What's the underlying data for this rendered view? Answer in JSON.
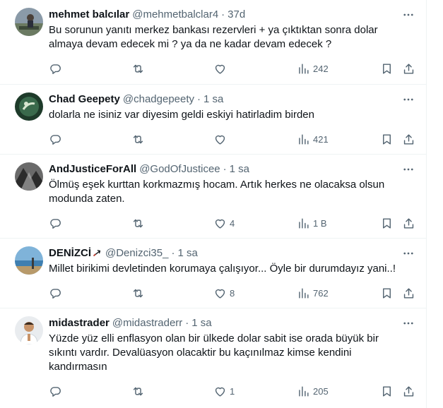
{
  "tweets": [
    {
      "name": "mehmet balcılar",
      "handle": "@mehmetbalclar4",
      "time": "37d",
      "text": "Bu sorunun yanıtı merkez bankası rezervleri + ya çıktıktan sonra dolar\nalmaya devam edecek mi ? ya da ne kadar devam edecek ?",
      "replies": "",
      "reposts": "",
      "likes": "",
      "views": "242"
    },
    {
      "name": "Chad Geepety",
      "handle": "@chadgepeety",
      "time": "1 sa",
      "text": "dolarla ne isiniz var diyesim geldi eskiyi hatirladim birden",
      "replies": "",
      "reposts": "",
      "likes": "",
      "views": "421"
    },
    {
      "name": "AndJusticeForAll",
      "handle": "@GodOfJusticee",
      "time": "1 sa",
      "text": "Ölmüş eşek kurttan korkmazmış hocam. Artık herkes ne olacaksa olsun\nmodunda zaten.",
      "replies": "",
      "reposts": "",
      "likes": "4",
      "views": "1 B"
    },
    {
      "name": "DENİZCİ",
      "handle": "@Denizci35_",
      "time": "1 sa",
      "text": "Millet birikimi devletinden korumaya çalışıyor... Öyle bir durumdayız yani..!",
      "replies": "",
      "reposts": "",
      "likes": "8",
      "views": "762"
    },
    {
      "name": "midastrader",
      "handle": "@midastraderr",
      "time": "1 sa",
      "text": "Yüzde yüz elli enflasyon olan bir ülkede dolar sabit ise orada büyük bir\nsıkıntı vardır. Devalüasyon olacaktir bu kaçınılmaz kimse kendini\nkandırmasın",
      "replies": "",
      "reposts": "",
      "likes": "1",
      "views": "205"
    }
  ],
  "separator": "·",
  "icons": {
    "more": "more-icon",
    "reply": "reply-icon",
    "repost": "repost-icon",
    "like": "heart-icon",
    "views": "views-icon",
    "bookmark": "bookmark-icon",
    "share": "share-icon",
    "badge": "anchor-icon"
  },
  "colors": {
    "text": "#0f1419",
    "secondary": "#536471",
    "border": "#eff3f4"
  }
}
